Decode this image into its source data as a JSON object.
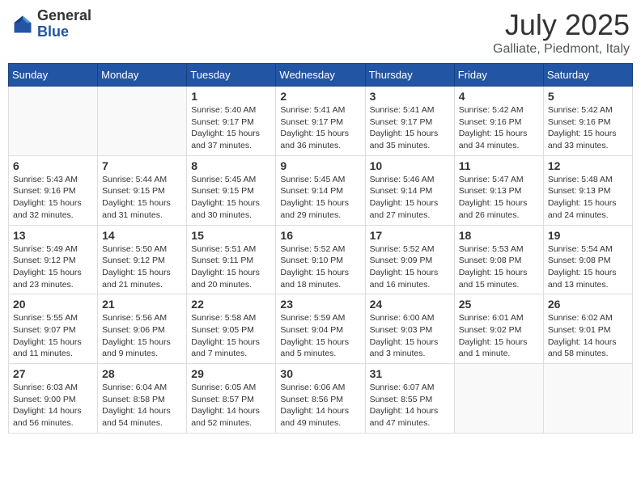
{
  "header": {
    "logo_general": "General",
    "logo_blue": "Blue",
    "month_year": "July 2025",
    "location": "Galliate, Piedmont, Italy"
  },
  "weekdays": [
    "Sunday",
    "Monday",
    "Tuesday",
    "Wednesday",
    "Thursday",
    "Friday",
    "Saturday"
  ],
  "weeks": [
    [
      {
        "day": "",
        "info": ""
      },
      {
        "day": "",
        "info": ""
      },
      {
        "day": "1",
        "info": "Sunrise: 5:40 AM\nSunset: 9:17 PM\nDaylight: 15 hours and 37 minutes."
      },
      {
        "day": "2",
        "info": "Sunrise: 5:41 AM\nSunset: 9:17 PM\nDaylight: 15 hours and 36 minutes."
      },
      {
        "day": "3",
        "info": "Sunrise: 5:41 AM\nSunset: 9:17 PM\nDaylight: 15 hours and 35 minutes."
      },
      {
        "day": "4",
        "info": "Sunrise: 5:42 AM\nSunset: 9:16 PM\nDaylight: 15 hours and 34 minutes."
      },
      {
        "day": "5",
        "info": "Sunrise: 5:42 AM\nSunset: 9:16 PM\nDaylight: 15 hours and 33 minutes."
      }
    ],
    [
      {
        "day": "6",
        "info": "Sunrise: 5:43 AM\nSunset: 9:16 PM\nDaylight: 15 hours and 32 minutes."
      },
      {
        "day": "7",
        "info": "Sunrise: 5:44 AM\nSunset: 9:15 PM\nDaylight: 15 hours and 31 minutes."
      },
      {
        "day": "8",
        "info": "Sunrise: 5:45 AM\nSunset: 9:15 PM\nDaylight: 15 hours and 30 minutes."
      },
      {
        "day": "9",
        "info": "Sunrise: 5:45 AM\nSunset: 9:14 PM\nDaylight: 15 hours and 29 minutes."
      },
      {
        "day": "10",
        "info": "Sunrise: 5:46 AM\nSunset: 9:14 PM\nDaylight: 15 hours and 27 minutes."
      },
      {
        "day": "11",
        "info": "Sunrise: 5:47 AM\nSunset: 9:13 PM\nDaylight: 15 hours and 26 minutes."
      },
      {
        "day": "12",
        "info": "Sunrise: 5:48 AM\nSunset: 9:13 PM\nDaylight: 15 hours and 24 minutes."
      }
    ],
    [
      {
        "day": "13",
        "info": "Sunrise: 5:49 AM\nSunset: 9:12 PM\nDaylight: 15 hours and 23 minutes."
      },
      {
        "day": "14",
        "info": "Sunrise: 5:50 AM\nSunset: 9:12 PM\nDaylight: 15 hours and 21 minutes."
      },
      {
        "day": "15",
        "info": "Sunrise: 5:51 AM\nSunset: 9:11 PM\nDaylight: 15 hours and 20 minutes."
      },
      {
        "day": "16",
        "info": "Sunrise: 5:52 AM\nSunset: 9:10 PM\nDaylight: 15 hours and 18 minutes."
      },
      {
        "day": "17",
        "info": "Sunrise: 5:52 AM\nSunset: 9:09 PM\nDaylight: 15 hours and 16 minutes."
      },
      {
        "day": "18",
        "info": "Sunrise: 5:53 AM\nSunset: 9:08 PM\nDaylight: 15 hours and 15 minutes."
      },
      {
        "day": "19",
        "info": "Sunrise: 5:54 AM\nSunset: 9:08 PM\nDaylight: 15 hours and 13 minutes."
      }
    ],
    [
      {
        "day": "20",
        "info": "Sunrise: 5:55 AM\nSunset: 9:07 PM\nDaylight: 15 hours and 11 minutes."
      },
      {
        "day": "21",
        "info": "Sunrise: 5:56 AM\nSunset: 9:06 PM\nDaylight: 15 hours and 9 minutes."
      },
      {
        "day": "22",
        "info": "Sunrise: 5:58 AM\nSunset: 9:05 PM\nDaylight: 15 hours and 7 minutes."
      },
      {
        "day": "23",
        "info": "Sunrise: 5:59 AM\nSunset: 9:04 PM\nDaylight: 15 hours and 5 minutes."
      },
      {
        "day": "24",
        "info": "Sunrise: 6:00 AM\nSunset: 9:03 PM\nDaylight: 15 hours and 3 minutes."
      },
      {
        "day": "25",
        "info": "Sunrise: 6:01 AM\nSunset: 9:02 PM\nDaylight: 15 hours and 1 minute."
      },
      {
        "day": "26",
        "info": "Sunrise: 6:02 AM\nSunset: 9:01 PM\nDaylight: 14 hours and 58 minutes."
      }
    ],
    [
      {
        "day": "27",
        "info": "Sunrise: 6:03 AM\nSunset: 9:00 PM\nDaylight: 14 hours and 56 minutes."
      },
      {
        "day": "28",
        "info": "Sunrise: 6:04 AM\nSunset: 8:58 PM\nDaylight: 14 hours and 54 minutes."
      },
      {
        "day": "29",
        "info": "Sunrise: 6:05 AM\nSunset: 8:57 PM\nDaylight: 14 hours and 52 minutes."
      },
      {
        "day": "30",
        "info": "Sunrise: 6:06 AM\nSunset: 8:56 PM\nDaylight: 14 hours and 49 minutes."
      },
      {
        "day": "31",
        "info": "Sunrise: 6:07 AM\nSunset: 8:55 PM\nDaylight: 14 hours and 47 minutes."
      },
      {
        "day": "",
        "info": ""
      },
      {
        "day": "",
        "info": ""
      }
    ]
  ]
}
